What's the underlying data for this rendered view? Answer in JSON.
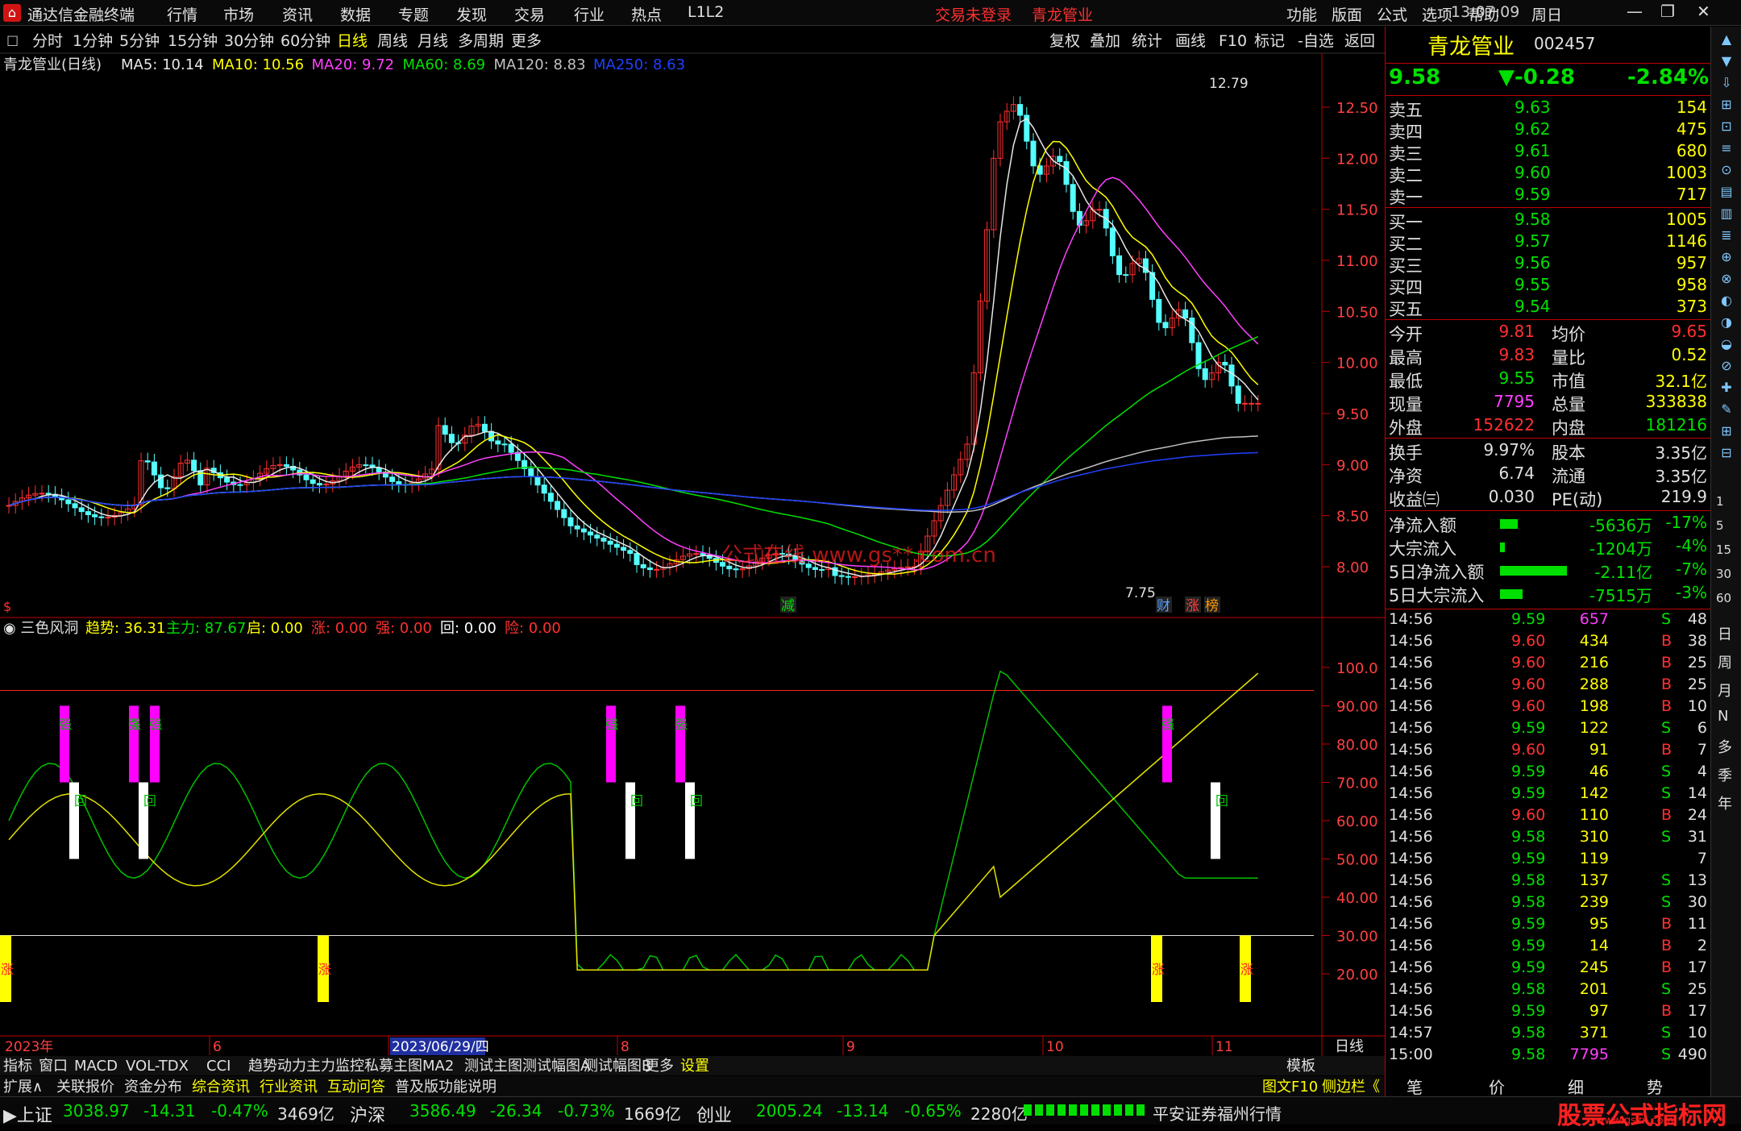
{
  "app": {
    "title": "通达信金融终端",
    "menu": [
      "行情",
      "市场",
      "资讯",
      "数据",
      "专题",
      "发现",
      "交易",
      "行业",
      "热点",
      "L1L2"
    ],
    "login": "交易未登录",
    "stock_name": "青龙管业",
    "right_menu": [
      "功能",
      "版面",
      "公式",
      "选项",
      "帮助"
    ],
    "time": "13:07:09",
    "weekday": "周日"
  },
  "periods": [
    "分时",
    "1分钟",
    "5分钟",
    "15分钟",
    "30分钟",
    "60分钟",
    "日线",
    "周线",
    "月线",
    "多周期",
    "更多"
  ],
  "active_period": "日线",
  "tools": [
    "复权",
    "叠加",
    "统计",
    "画线",
    "F10",
    "标记",
    "-自选",
    "返回"
  ],
  "ma_legend": {
    "name": "青龙管业(日线)",
    "items": [
      {
        "label": "MA5: 10.14",
        "color": "#e8e8e8"
      },
      {
        "label": "MA10: 10.56",
        "color": "#ffff00"
      },
      {
        "label": "MA20: 9.72",
        "color": "#ff40ff"
      },
      {
        "label": "MA60: 8.69",
        "color": "#00e000"
      },
      {
        "label": "MA120: 8.83",
        "color": "#c0c0c0"
      },
      {
        "label": "MA250: 8.63",
        "color": "#2040ff"
      }
    ]
  },
  "price_axis": [
    "12.50",
    "12.00",
    "11.50",
    "11.00",
    "10.50",
    "10.00",
    "9.50",
    "9.00",
    "8.50",
    "8.00"
  ],
  "high_label": "12.79",
  "low_label": "7.75",
  "watermark": "公式在线 www.gs**.com.cn",
  "event_marks": [
    {
      "text": "减",
      "color": "#00e000"
    },
    {
      "text": "财",
      "color": "#5aa0ff"
    },
    {
      "text": "涨",
      "color": "#ff4040"
    },
    {
      "text": "榜",
      "color": "#ff9900"
    }
  ],
  "indicator": {
    "name": "三色风洞",
    "items": [
      {
        "label": "趋势:",
        "value": "36.31",
        "color": "#ffff00"
      },
      {
        "label": "主力:",
        "value": "87.67",
        "color": "#00e000"
      },
      {
        "label": "启:",
        "value": "0.00",
        "color": "#ffff00"
      },
      {
        "label": "涨:",
        "value": "0.00",
        "color": "#ff3030"
      },
      {
        "label": "强:",
        "value": "0.00",
        "color": "#ff3030"
      },
      {
        "label": "回:",
        "value": "0.00",
        "color": "#ffffff"
      },
      {
        "label": "险:",
        "value": "0.00",
        "color": "#ff3030"
      }
    ]
  },
  "ind_axis": [
    "100.0",
    "90.00",
    "80.00",
    "70.00",
    "60.00",
    "50.00",
    "40.00",
    "30.00",
    "20.00"
  ],
  "ind_marks": {
    "strong": "强",
    "back": "回",
    "rise": "涨"
  },
  "date_axis": {
    "year": "2023年",
    "labels": [
      "6",
      "2023/06/29/四",
      "8",
      "9",
      "10",
      "11"
    ],
    "right": "日线"
  },
  "bottom_tabs": [
    "指标",
    "窗口",
    "MACD",
    "VOL-TDX",
    "CCI",
    "趋势动力",
    "主力监控",
    "私募主图",
    "MA2",
    "测试主图",
    "测试幅图A",
    "测试幅图B",
    "更多",
    "设置"
  ],
  "template_label": "模板",
  "bottom_tabs2": [
    "扩展∧",
    "关联报价",
    "资金分布",
    "综合资讯",
    "行业资讯",
    "互动问答",
    "普及版功能说明"
  ],
  "f10_link": "图文F10",
  "side_link": "侧边栏《",
  "quote": {
    "name": "青龙管业",
    "code": "002457",
    "price": "9.58",
    "change": "▼-0.28",
    "pct": "-2.84%",
    "asks": [
      [
        "卖五",
        "9.63",
        "154"
      ],
      [
        "卖四",
        "9.62",
        "475"
      ],
      [
        "卖三",
        "9.61",
        "680"
      ],
      [
        "卖二",
        "9.60",
        "1003"
      ],
      [
        "卖一",
        "9.59",
        "717"
      ]
    ],
    "bids": [
      [
        "买一",
        "9.58",
        "1005"
      ],
      [
        "买二",
        "9.57",
        "1146"
      ],
      [
        "买三",
        "9.56",
        "957"
      ],
      [
        "买四",
        "9.55",
        "958"
      ],
      [
        "买五",
        "9.54",
        "373"
      ]
    ],
    "stats": [
      [
        "今开",
        "9.81",
        "#ff3030",
        "均价",
        "9.65",
        "#ff3030"
      ],
      [
        "最高",
        "9.83",
        "#ff3030",
        "量比",
        "0.52",
        "#ffff00"
      ],
      [
        "最低",
        "9.55",
        "#00e000",
        "市值",
        "32.1亿",
        "#ffff00"
      ],
      [
        "现量",
        "7795",
        "#ff40ff",
        "总量",
        "333838",
        "#ffff00"
      ],
      [
        "外盘",
        "152622",
        "#ff3030",
        "内盘",
        "181216",
        "#00e000"
      ]
    ],
    "stats2": [
      [
        "换手",
        "9.97%",
        "股本",
        "3.35亿"
      ],
      [
        "净资",
        "6.74",
        "流通",
        "3.35亿"
      ],
      [
        "收益㈢",
        "0.030",
        "PE(动)",
        "219.9"
      ]
    ],
    "flows": [
      [
        "净流入额",
        "-5636万",
        "-17%",
        0.2
      ],
      [
        "大宗流入",
        "-1204万",
        "-4%",
        0.05
      ],
      [
        "5日净流入额",
        "-2.11亿",
        "-7%",
        0.75
      ],
      [
        "5日大宗流入",
        "-7515万",
        "-3%",
        0.25
      ]
    ],
    "ticks": [
      [
        "14:56",
        "9.59",
        "657",
        "S",
        "48"
      ],
      [
        "14:56",
        "9.60",
        "434",
        "B",
        "38"
      ],
      [
        "14:56",
        "9.60",
        "216",
        "B",
        "25"
      ],
      [
        "14:56",
        "9.60",
        "288",
        "B",
        "25"
      ],
      [
        "14:56",
        "9.60",
        "198",
        "B",
        "10"
      ],
      [
        "14:56",
        "9.59",
        "122",
        "S",
        "6"
      ],
      [
        "14:56",
        "9.60",
        "91",
        "B",
        "7"
      ],
      [
        "14:56",
        "9.59",
        "46",
        "S",
        "4"
      ],
      [
        "14:56",
        "9.59",
        "142",
        "S",
        "14"
      ],
      [
        "14:56",
        "9.60",
        "110",
        "B",
        "24"
      ],
      [
        "14:56",
        "9.58",
        "310",
        "S",
        "31"
      ],
      [
        "14:56",
        "9.59",
        "119",
        "",
        "7"
      ],
      [
        "14:56",
        "9.58",
        "137",
        "S",
        "13"
      ],
      [
        "14:56",
        "9.58",
        "239",
        "S",
        "30"
      ],
      [
        "14:56",
        "9.59",
        "95",
        "B",
        "11"
      ],
      [
        "14:56",
        "9.59",
        "14",
        "B",
        "2"
      ],
      [
        "14:56",
        "9.59",
        "245",
        "B",
        "17"
      ],
      [
        "14:56",
        "9.58",
        "201",
        "S",
        "25"
      ],
      [
        "14:56",
        "9.59",
        "97",
        "B",
        "17"
      ],
      [
        "14:57",
        "9.58",
        "371",
        "S",
        "10"
      ],
      [
        "15:00",
        "9.58",
        "7795",
        "S",
        "490"
      ]
    ],
    "bottom_tabs": [
      "笔",
      "价",
      "细",
      "势"
    ]
  },
  "side_buttons": [
    "日",
    "周",
    "月",
    "N",
    "多",
    "季",
    "年"
  ],
  "index_bar": [
    {
      "name": "上证",
      "value": "3038.97",
      "chg": "-14.31",
      "pct": "-0.47%",
      "amt": "3469亿"
    },
    {
      "name": "沪深",
      "value": "3586.49",
      "chg": "-26.34",
      "pct": "-0.73%",
      "amt": "1669亿"
    },
    {
      "name": "创业",
      "value": "2005.24",
      "chg": "-13.14",
      "pct": "-0.65%",
      "amt": "2280亿"
    }
  ],
  "broker": "平安证券福州行情",
  "brand": "股票公式指标网",
  "brand_url": "www.gszx.com"
}
